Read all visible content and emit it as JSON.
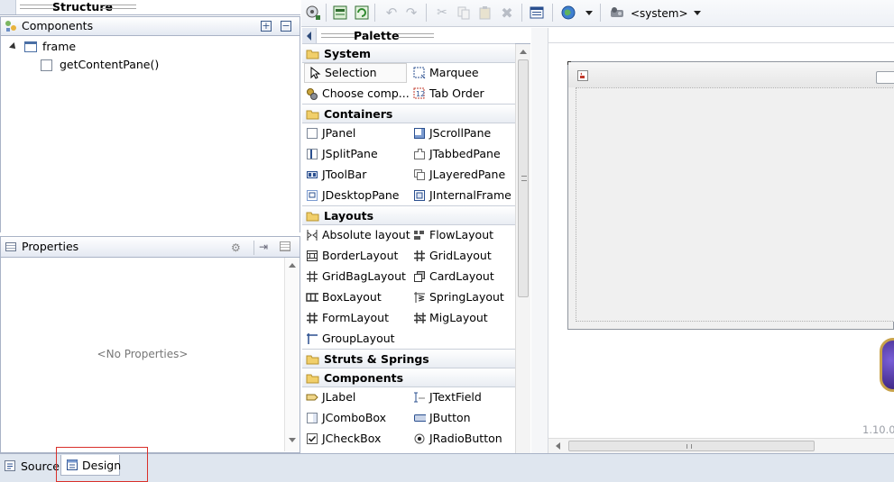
{
  "structure": {
    "title": "Structure",
    "components_label": "Components",
    "tree": [
      {
        "label": "frame"
      },
      {
        "label": "getContentPane()"
      }
    ]
  },
  "properties": {
    "title": "Properties",
    "empty_text": "<No Properties>"
  },
  "toolbar": {
    "system_label": "<system>"
  },
  "palette": {
    "title": "Palette",
    "categories": [
      {
        "name": "System",
        "items": [
          "Selection",
          "Marquee",
          "Choose comp...",
          "Tab Order"
        ]
      },
      {
        "name": "Containers",
        "items": [
          "JPanel",
          "JScrollPane",
          "JSplitPane",
          "JTabbedPane",
          "JToolBar",
          "JLayeredPane",
          "JDesktopPane",
          "JInternalFrame"
        ]
      },
      {
        "name": "Layouts",
        "items": [
          "Absolute layout",
          "FlowLayout",
          "BorderLayout",
          "GridLayout",
          "GridBagLayout",
          "CardLayout",
          "BoxLayout",
          "SpringLayout",
          "FormLayout",
          "MigLayout",
          "GroupLayout"
        ]
      },
      {
        "name": "Struts & Springs",
        "items": []
      },
      {
        "name": "Components",
        "items": [
          "JLabel",
          "JTextField",
          "JComboBox",
          "JButton",
          "JCheckBox",
          "JRadioButton"
        ]
      }
    ]
  },
  "canvas": {
    "version": "1.10.0"
  },
  "bottom_tabs": {
    "source": "Source",
    "design": "Design"
  }
}
